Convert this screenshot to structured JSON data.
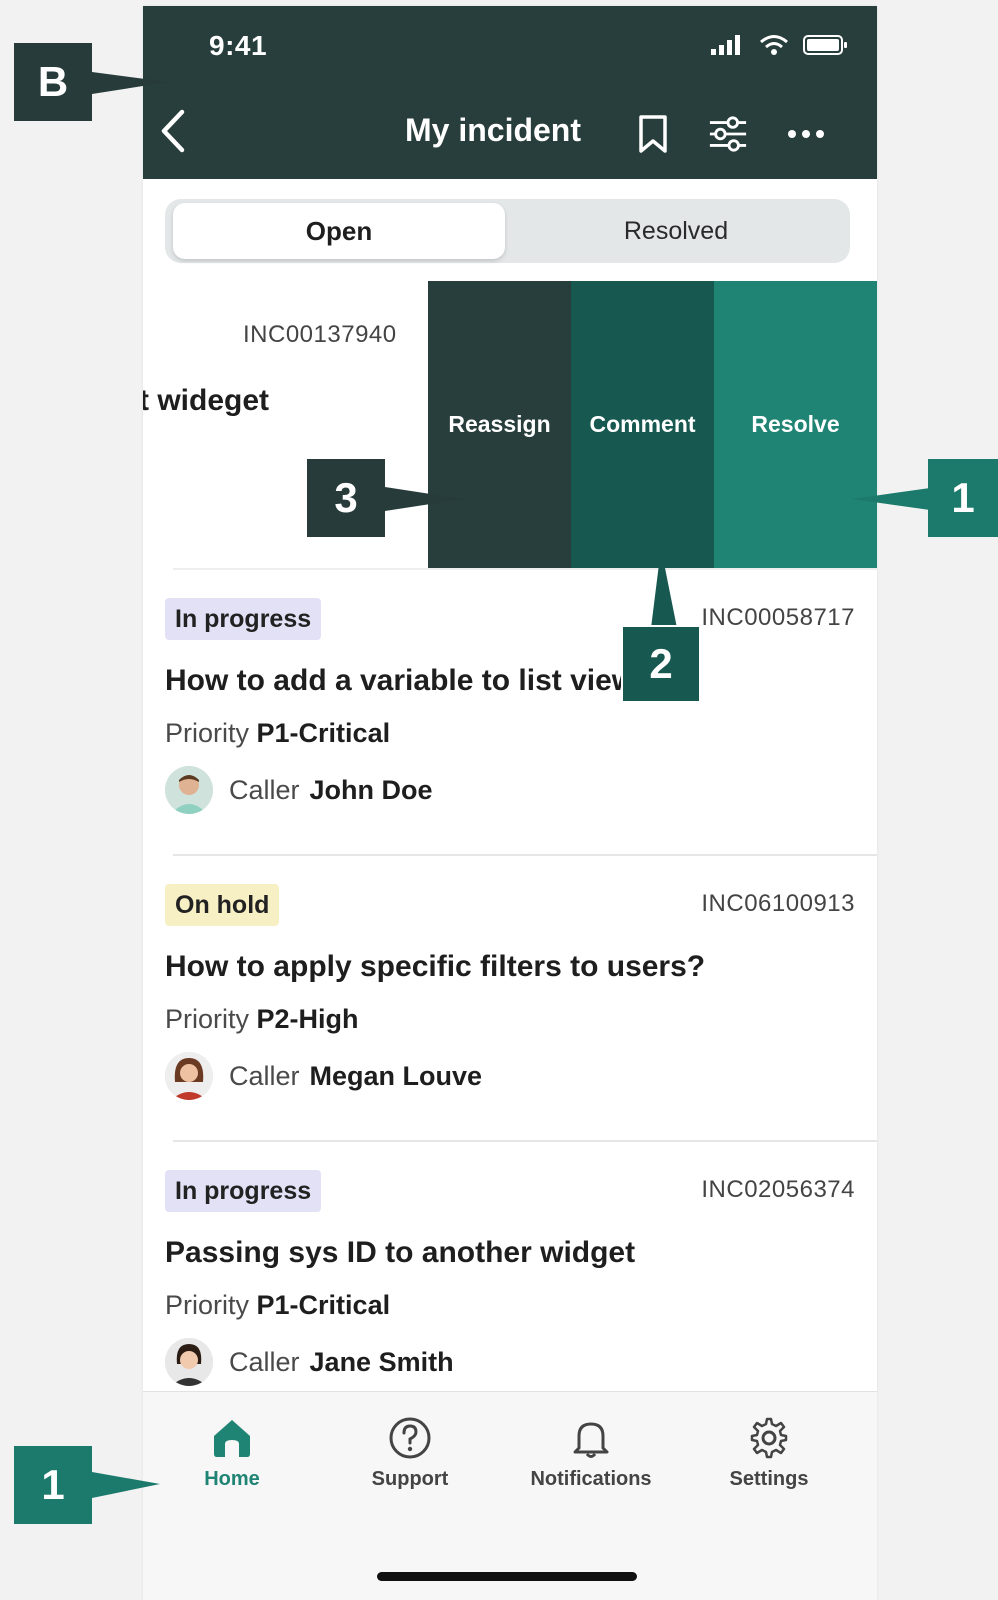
{
  "status_bar": {
    "time": "9:41"
  },
  "header": {
    "title": "My incident",
    "icons": [
      "back-chevron-icon",
      "bookmark-icon",
      "filter-sliders-icon",
      "more-dots-icon"
    ]
  },
  "segmented": {
    "open": "Open",
    "resolved": "Resolved",
    "selected": "Open"
  },
  "swiped_row": {
    "number": "INC00137940",
    "title_partial": "t wideget",
    "actions": [
      "Reassign",
      "Comment",
      "Resolve"
    ]
  },
  "incidents": [
    {
      "status": "In progress",
      "number": "INC00058717",
      "title": "How to add a variable to list views",
      "priority_label": "Priority",
      "priority": "P1-Critical",
      "caller_label": "Caller",
      "caller": "John Doe"
    },
    {
      "status": "On hold",
      "number": "INC06100913",
      "title": "How to apply specific filters to users?",
      "priority_label": "Priority",
      "priority": "P2-High",
      "caller_label": "Caller",
      "caller": "Megan Louve"
    },
    {
      "status": "In progress",
      "number": "INC02056374",
      "title": "Passing sys ID to another widget",
      "priority_label": "Priority",
      "priority": "P1-Critical",
      "caller_label": "Caller",
      "caller": "Jane Smith"
    }
  ],
  "bottom_nav": [
    {
      "label": "Home",
      "icon": "home-icon",
      "active": true
    },
    {
      "label": "Support",
      "icon": "question-circle-icon",
      "active": false
    },
    {
      "label": "Notifications",
      "icon": "bell-icon",
      "active": false
    },
    {
      "label": "Settings",
      "icon": "gear-icon",
      "active": false
    }
  ],
  "callouts": {
    "b": "B",
    "one_top": "1",
    "two": "2",
    "three": "3",
    "one_bottom": "1"
  },
  "colors": {
    "header": "#283e3c",
    "reassign": "#283e3c",
    "comment": "#175850",
    "resolve": "#1f8474",
    "accent": "#1f8474"
  }
}
